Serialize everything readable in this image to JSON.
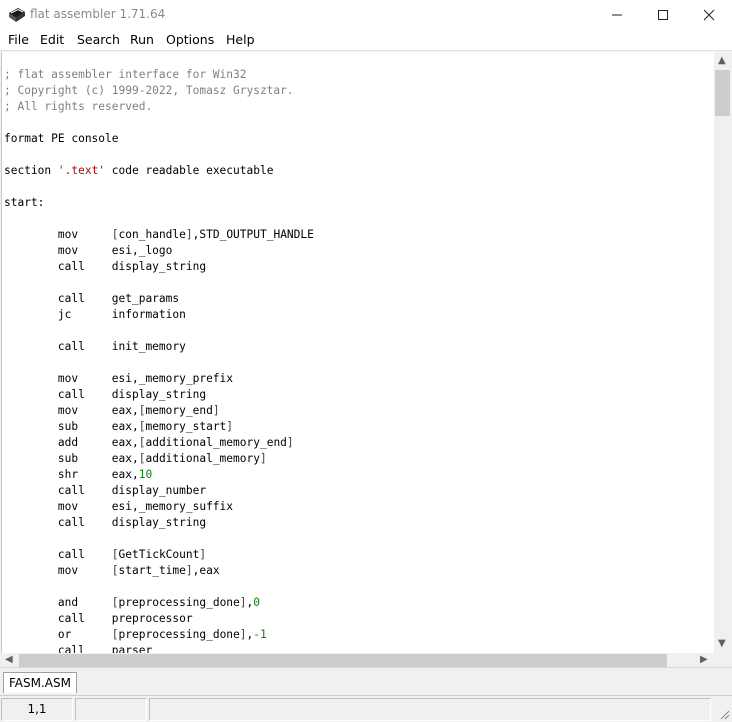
{
  "window": {
    "title": "flat assembler 1.71.64"
  },
  "menu": [
    "File",
    "Edit",
    "Search",
    "Run",
    "Options",
    "Help"
  ],
  "editor": {
    "lines": [
      "; flat assembler interface for Win32",
      "; Copyright (c) 1999-2022, Tomasz Grysztar.",
      "; All rights reserved.",
      "",
      "format PE console",
      "",
      "section '.text' code readable executable",
      "",
      "start:",
      "",
      "\tmov\t[con_handle],STD_OUTPUT_HANDLE",
      "\tmov\tesi,_logo",
      "\tcall\tdisplay_string",
      "",
      "\tcall\tget_params",
      "\tjc\tinformation",
      "",
      "\tcall\tinit_memory",
      "",
      "\tmov\tesi,_memory_prefix",
      "\tcall\tdisplay_string",
      "\tmov\teax,[memory_end]",
      "\tsub\teax,[memory_start]",
      "\tadd\teax,[additional_memory_end]",
      "\tsub\teax,[additional_memory]",
      "\tshr\teax,10",
      "\tcall\tdisplay_number",
      "\tmov\tesi,_memory_suffix",
      "\tcall\tdisplay_string",
      "",
      "\tcall\t[GetTickCount]",
      "\tmov\t[start_time],eax",
      "",
      "\tand\t[preprocessing_done],0",
      "\tcall\tpreprocessor",
      "\tor\t[preprocessing_done],-1",
      "\tcall\tparser"
    ]
  },
  "tabs": [
    "FASM.ASM"
  ],
  "status": {
    "position": "1,1",
    "cell2": "",
    "cell3": ""
  },
  "colors": {
    "comment": "#808080",
    "string": "#a01010",
    "number": "#108010"
  }
}
